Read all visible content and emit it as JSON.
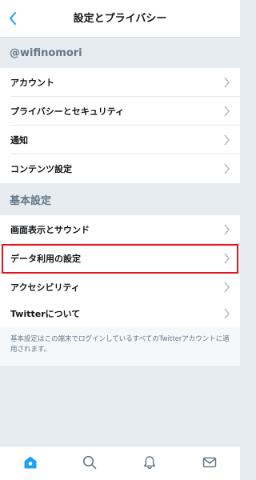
{
  "header": {
    "title": "設定とプライバシー",
    "back_icon": "chevron-left-icon"
  },
  "account_section": {
    "username": "@wifinomori",
    "items": [
      {
        "label": "アカウント"
      },
      {
        "label": "プライバシーとセキュリティ"
      },
      {
        "label": "通知"
      },
      {
        "label": "コンテンツ設定"
      }
    ]
  },
  "general_section": {
    "title": "基本設定",
    "items": [
      {
        "label": "画面表示とサウンド"
      },
      {
        "label": "データ利用の設定"
      },
      {
        "label": "アクセシビリティ"
      },
      {
        "label": "Twitterについて"
      }
    ],
    "footnote": "基本設定はこの端末でログインしているすべてのTwitterアカウントに適用されます。"
  },
  "tabbar": {
    "tabs": [
      {
        "icon": "home-icon",
        "active": true
      },
      {
        "icon": "search-icon",
        "active": false
      },
      {
        "icon": "bell-icon",
        "active": false
      },
      {
        "icon": "mail-icon",
        "active": false
      }
    ]
  },
  "colors": {
    "accent": "#1da1f2",
    "highlight_border": "#e8131c",
    "group_background": "#e6ecf0"
  }
}
